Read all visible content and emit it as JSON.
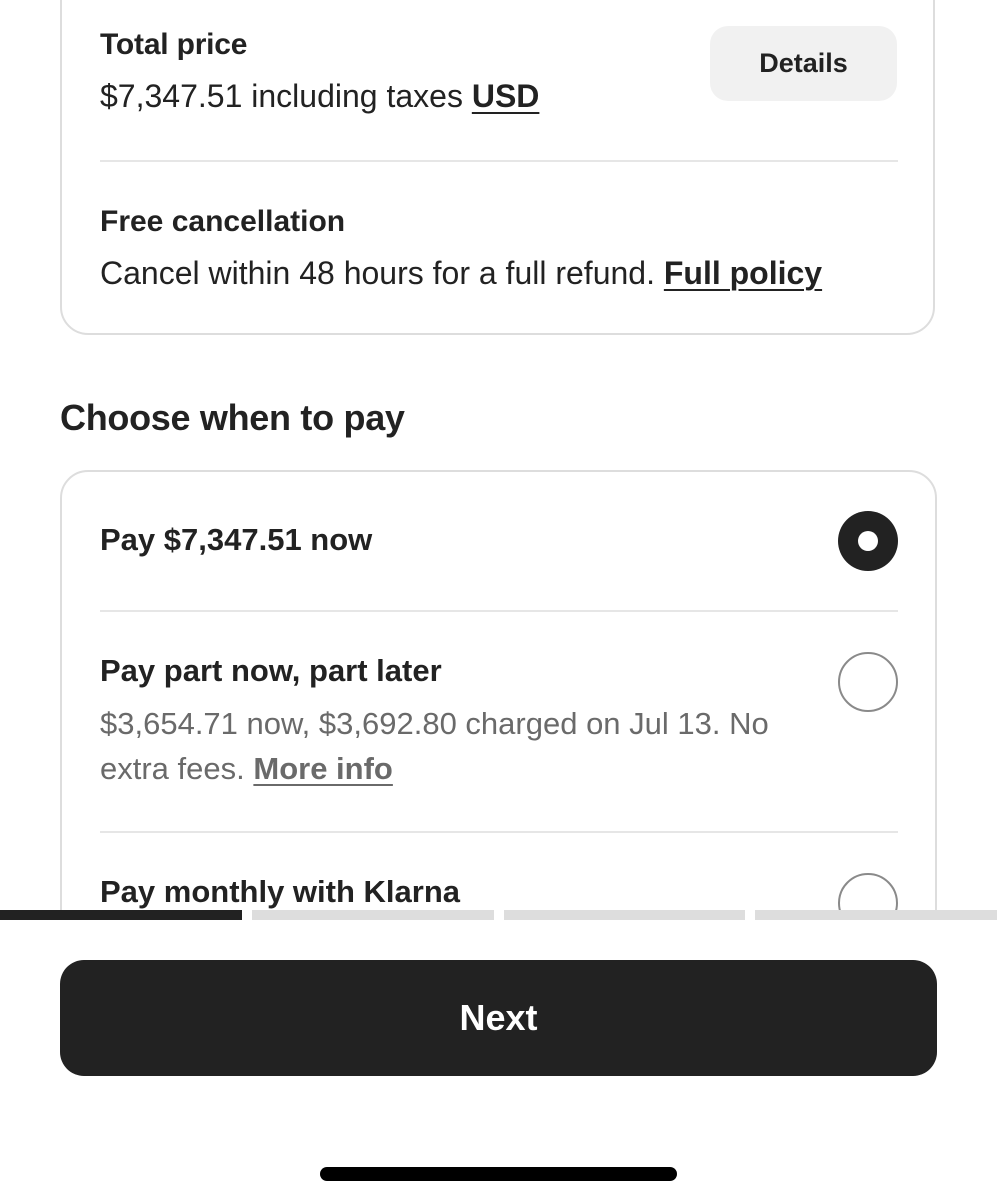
{
  "price_card": {
    "title": "Total price",
    "amount_text": "$7,347.51 including taxes",
    "currency_link": "USD",
    "details_button": "Details"
  },
  "cancellation": {
    "title": "Free cancellation",
    "text": "Cancel within 48 hours for a full refund.",
    "policy_link": "Full policy"
  },
  "pay_section": {
    "heading": "Choose when to pay",
    "options": [
      {
        "title": "Pay $7,347.51 now",
        "selected": true
      },
      {
        "title": "Pay part now, part later",
        "description": "$3,654.71 now,  $3,692.80 charged on Jul 13. No extra fees.",
        "link": "More info",
        "selected": false
      },
      {
        "title": "Pay monthly with Klarna",
        "selected": false
      }
    ]
  },
  "progress": {
    "total_steps": 4,
    "current_step": 1
  },
  "footer": {
    "next_button": "Next"
  }
}
